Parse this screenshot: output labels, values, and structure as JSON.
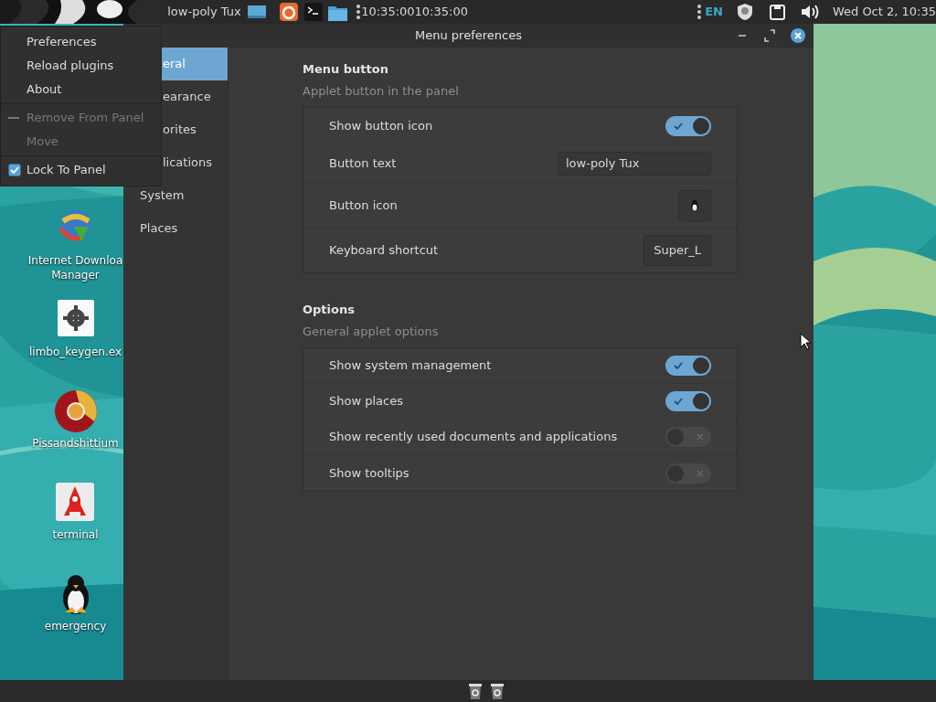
{
  "top_panel": {
    "menu_label": "low-poly Tux",
    "clock_applet": "10:35:0010:35:00",
    "keyboard_layout": "EN",
    "datetime": "Wed Oct 2, 10:35"
  },
  "context_menu": {
    "items": [
      {
        "kind": "item",
        "label": "Preferences",
        "disabled": false
      },
      {
        "kind": "item",
        "label": "Reload plugins",
        "disabled": false
      },
      {
        "kind": "item",
        "label": "About",
        "disabled": false
      },
      {
        "kind": "separator"
      },
      {
        "kind": "remove",
        "label": "Remove From Panel",
        "disabled": true
      },
      {
        "kind": "item",
        "label": "Move",
        "disabled": true
      },
      {
        "kind": "separator"
      },
      {
        "kind": "check",
        "label": "Lock To Panel",
        "checked": true,
        "disabled": false
      }
    ]
  },
  "desktop_icons": [
    {
      "kind": "download",
      "lines": [
        "Internet Downloa",
        "Manager"
      ]
    },
    {
      "kind": "gear",
      "lines": [
        "limbo_keygen.ex"
      ]
    },
    {
      "kind": "browser",
      "lines": [
        "Pissandshittium"
      ]
    },
    {
      "kind": "rocket",
      "lines": [
        "terminal"
      ]
    },
    {
      "kind": "penguin",
      "lines": [
        "emergency"
      ]
    }
  ],
  "window": {
    "title": "Menu preferences",
    "sidebar": [
      {
        "label": "eral",
        "selected": true
      },
      {
        "label": "earance",
        "selected": false
      },
      {
        "label": "orites",
        "selected": false
      },
      {
        "label": "lications",
        "selected": false
      },
      {
        "label": "System",
        "selected": false
      },
      {
        "label": "Places",
        "selected": false
      }
    ],
    "sections": [
      {
        "title": "Menu button",
        "subtitle": "Applet button in the panel",
        "rows": [
          {
            "kind": "switch",
            "label": "Show button icon",
            "on": true
          },
          {
            "kind": "entry",
            "label": "Button text",
            "value": "low-poly Tux"
          },
          {
            "kind": "icon_button",
            "label": "Button icon"
          },
          {
            "kind": "button",
            "label": "Keyboard shortcut",
            "value": "Super_L"
          }
        ]
      },
      {
        "title": "Options",
        "subtitle": "General applet options",
        "rows": [
          {
            "kind": "switch",
            "label": "Show system management",
            "on": true
          },
          {
            "kind": "switch",
            "label": "Show places",
            "on": true
          },
          {
            "kind": "switch",
            "label": "Show recently used documents and applications",
            "on": false
          },
          {
            "kind": "switch",
            "label": "Show tooltips",
            "on": false
          }
        ]
      }
    ]
  }
}
